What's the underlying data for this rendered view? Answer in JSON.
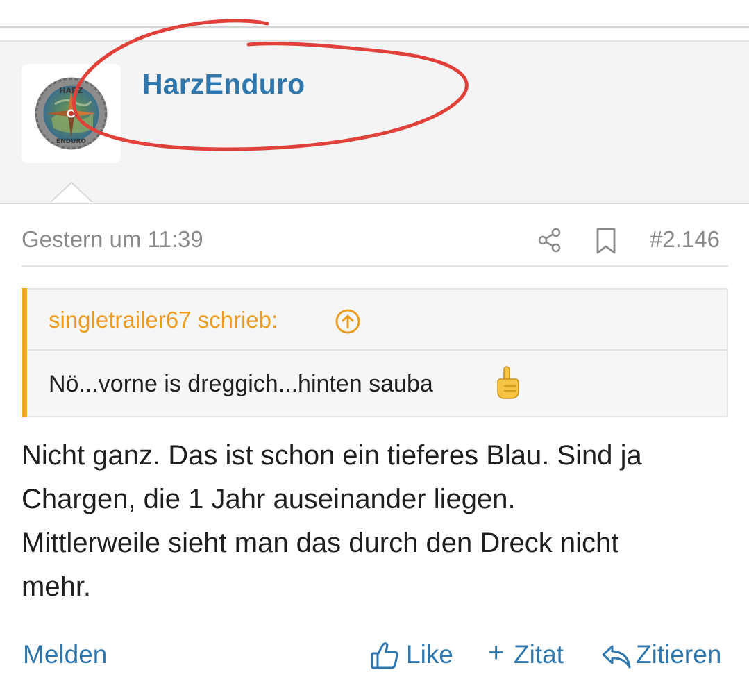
{
  "post": {
    "author": "HarzEnduro",
    "avatar_icon": "harz-enduro-compass-logo",
    "avatar_text_top": "HARZ",
    "avatar_text_bottom": "ENDURO",
    "timestamp": "Gestern um 11:39",
    "post_number": "#2.146",
    "quote": {
      "author_line": "singletrailer67 schrieb:",
      "text": "Nö...vorne is dreggich...hinten sauba"
    },
    "body_lines": [
      "Nicht ganz. Das ist schon ein tieferes Blau. Sind ja",
      "Chargen, die 1 Jahr auseinander liegen.",
      "Mittlerweile sieht man das durch den Dreck nicht",
      "mehr."
    ]
  },
  "actions": {
    "report": "Melden",
    "like": "Like",
    "quote_add": "Zitat",
    "reply": "Zitieren"
  },
  "colors": {
    "link": "#2f76ad",
    "quote_accent": "#f5a623",
    "annotation": "#e0413a"
  },
  "icons": [
    "share-icon",
    "bookmark-icon",
    "arrow-up-circle-icon",
    "thumbs-up-icon",
    "plus-icon",
    "reply-icon"
  ]
}
